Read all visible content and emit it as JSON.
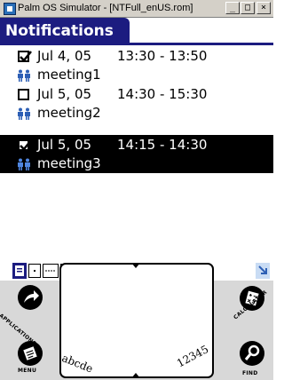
{
  "window": {
    "title": "Palm OS Simulator - [NTFull_enUS.rom]",
    "minimize": "_",
    "maximize": "□",
    "close": "×"
  },
  "form": {
    "title": "Notifications"
  },
  "notifications": [
    {
      "checked": true,
      "selected": false,
      "date": "Jul 4, 05",
      "time": "13:30 - 13:50",
      "name": "meeting1"
    },
    {
      "checked": false,
      "selected": false,
      "date": "Jul 5, 05",
      "time": "14:30 - 15:30",
      "name": "meeting2"
    },
    {
      "checked": true,
      "selected": true,
      "date": "Jul 5, 05",
      "time": "14:15 - 14:30",
      "name": "meeting3"
    }
  ],
  "toolbar": {
    "icons": [
      "details-view-icon",
      "page-dot-icon",
      "list-view-icon",
      "grid-view-icon",
      "new-icon",
      "attendee-icon",
      "edit-icon",
      "goto-icon"
    ]
  },
  "silkscreen": {
    "applications": "APPLICATIONS",
    "menu": "MENU",
    "calculator": "CALCULATOR",
    "find": "FIND",
    "graffiti_left": "abcde",
    "graffiti_right": "12345"
  },
  "colors": {
    "palm_title": "#1c1c80",
    "windows_chrome": "#d4d0c8",
    "graffiti_bg": "#d8d8d8"
  }
}
